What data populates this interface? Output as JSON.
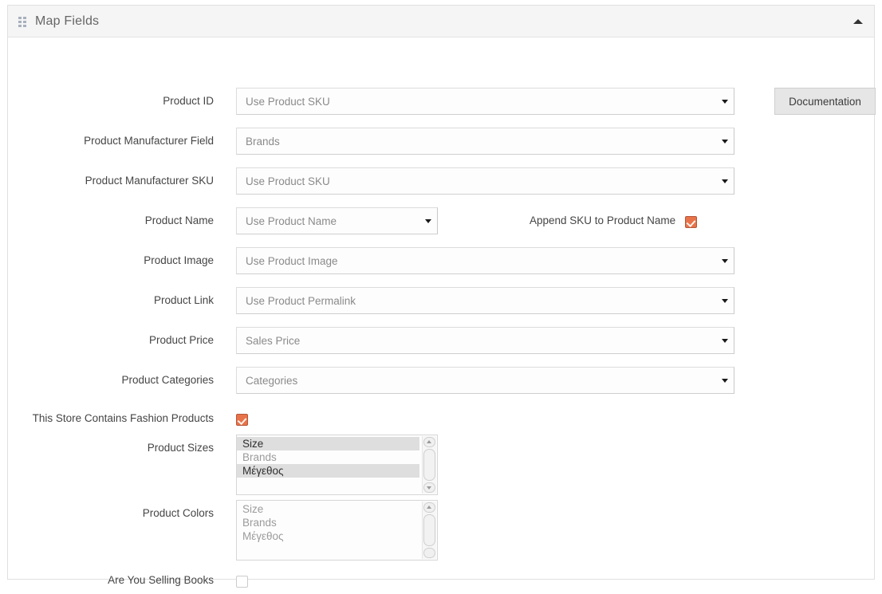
{
  "panel": {
    "title": "Map Fields",
    "grip_icon": "grip-dots-icon",
    "collapse_icon": "chevron-up-icon"
  },
  "documentation_button": {
    "label": "Documentation"
  },
  "fields": [
    {
      "label": "Product ID",
      "value": "Use Product SKU",
      "type": "select",
      "width": "wide"
    },
    {
      "label": "Product Manufacturer Field",
      "value": "Brands",
      "type": "select",
      "width": "wide"
    },
    {
      "label": "Product Manufacturer SKU",
      "value": "Use Product SKU",
      "type": "select",
      "width": "wide"
    },
    {
      "label": "Product Name",
      "value": "Use Product Name",
      "type": "select",
      "width": "narrow"
    },
    {
      "label": "Product Image",
      "value": "Use Product Image",
      "type": "select",
      "width": "wide"
    },
    {
      "label": "Product Link",
      "value": "Use Product Permalink",
      "type": "select",
      "width": "wide"
    },
    {
      "label": "Product Price",
      "value": "Sales Price",
      "type": "select",
      "width": "wide"
    },
    {
      "label": "Product Categories",
      "value": "Categories",
      "type": "select",
      "width": "wide"
    }
  ],
  "append_sku": {
    "label": "Append SKU to Product Name",
    "checked": true
  },
  "fashion_products": {
    "label": "This Store Contains Fashion Products",
    "checked": true
  },
  "product_sizes": {
    "label": "Product Sizes",
    "options": [
      {
        "label": "Size",
        "selected": true
      },
      {
        "label": "Brands",
        "selected": false
      },
      {
        "label": "Μέγεθος",
        "selected": true
      }
    ]
  },
  "product_colors": {
    "label": "Product Colors",
    "options": [
      {
        "label": "Size",
        "selected": false
      },
      {
        "label": "Brands",
        "selected": false
      },
      {
        "label": "Μέγεθος",
        "selected": false
      }
    ]
  },
  "selling_books": {
    "label": "Are You Selling Books",
    "checked": false
  },
  "colors": {
    "accent_checkbox": "#e8734a",
    "header_bg": "#f5f5f5",
    "panel_border": "#e0e0e0",
    "select_text": "#8a8a8a"
  }
}
